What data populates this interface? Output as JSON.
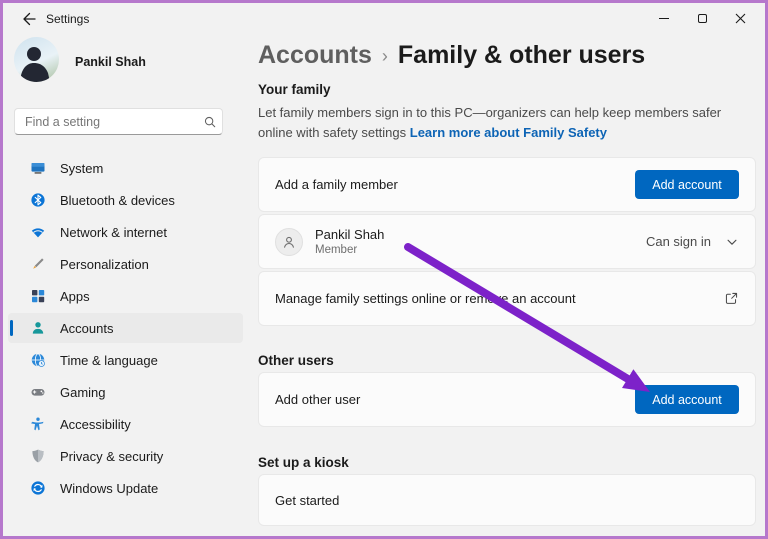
{
  "window": {
    "title": "Settings"
  },
  "sidebar": {
    "user": {
      "name": "Pankil Shah"
    },
    "search": {
      "placeholder": "Find a setting"
    },
    "items": [
      {
        "label": "System",
        "icon": "system-icon"
      },
      {
        "label": "Bluetooth & devices",
        "icon": "bluetooth-icon"
      },
      {
        "label": "Network & internet",
        "icon": "network-icon"
      },
      {
        "label": "Personalization",
        "icon": "personalization-icon"
      },
      {
        "label": "Apps",
        "icon": "apps-icon"
      },
      {
        "label": "Accounts",
        "icon": "accounts-icon",
        "selected": true
      },
      {
        "label": "Time & language",
        "icon": "time-language-icon"
      },
      {
        "label": "Gaming",
        "icon": "gaming-icon"
      },
      {
        "label": "Accessibility",
        "icon": "accessibility-icon"
      },
      {
        "label": "Privacy & security",
        "icon": "privacy-shield-icon"
      },
      {
        "label": "Windows Update",
        "icon": "windows-update-icon"
      }
    ]
  },
  "header": {
    "breadcrumb_root": "Accounts",
    "breadcrumb_separator": "›",
    "page_title": "Family & other users"
  },
  "your_family": {
    "heading": "Your family",
    "description": "Let family members sign in to this PC—organizers can help keep members safer online with safety settings",
    "link_label": "Learn more about Family Safety",
    "add_member_row": {
      "label": "Add a family member",
      "button_label": "Add account"
    },
    "member_row": {
      "name": "Pankil Shah",
      "role": "Member",
      "status": "Can sign in"
    },
    "manage_row": {
      "label": "Manage family settings online or remove an account"
    }
  },
  "other_users": {
    "heading": "Other users",
    "add_user_row": {
      "label": "Add other user",
      "button_label": "Add account"
    }
  },
  "kiosk": {
    "heading": "Set up a kiosk",
    "row_label": "Get started"
  },
  "colors": {
    "accent_blue": "#0067c0",
    "link_blue": "#0d64b5",
    "annotation_purple": "#7d22c9",
    "frame_border_purple": "#b678cc",
    "background": "#f2f2f2",
    "card_background": "#fbfbfb"
  }
}
